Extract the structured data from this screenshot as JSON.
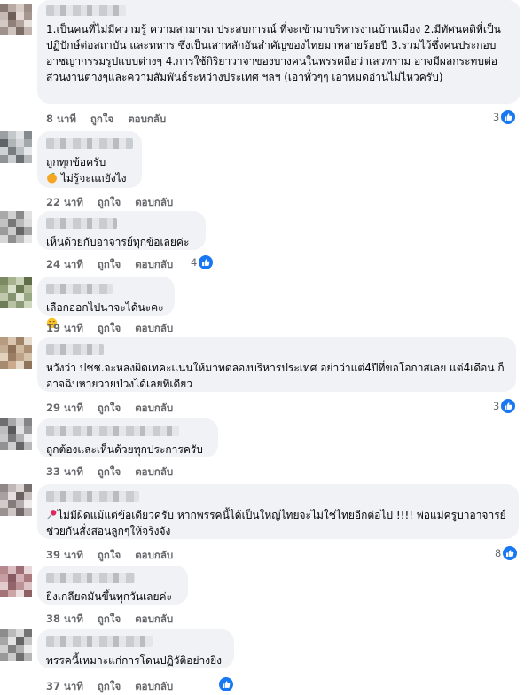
{
  "labels": {
    "like": "ถูกใจ",
    "reply": "ตอบกลับ"
  },
  "comments": [
    {
      "text": "1.เป็นคนที่ไม่มีความรู้ ความสามารถ ประสบการณ์ ที่จะเข้ามาบริหารงานบ้านเมือง 2.มีทัศนคติที่เป็นปฏิปักษ์ต่อสถาบัน และทหาร ซึ่งเป็นเสาหลักอันสำคัญของไทยมาหลายร้อยปี 3.รวมไว้ซึ่งคนประกอบอาชญากรรมรูปแบบต่างๆ 4.การใช้กิริยาวาจาของบางคนในพรรคถือว่าเลวทราม อาจมีผลกระทบต่อส่วนงานต่างๆและความสัมพันธ์ระหว่างประเทศ ฯลฯ (เอาทั่วๆๆ เอาหมดอ่านไม่ไหวครับ)",
      "time": "8 นาที",
      "likes": "3"
    },
    {
      "text": "ถูกทุกข้อครับ",
      "text2": "ไม่รู้จะแถยังไง",
      "time": "22 นาที",
      "likes": ""
    },
    {
      "text": "เห็นด้วยกับอาจารย์ทุกข้อเลยค่ะ",
      "time": "24 นาที",
      "likes": "4"
    },
    {
      "text": "เลือกออกไปน่าจะได้นะคะ",
      "time": "19 นาที",
      "likes": ""
    },
    {
      "text": "หวังว่า ปชช.จะหลงผิดเทคะแนนให้มาทดลองบริหารประเทศ อย่าว่าแต่4ปีที่ขอโอกาสเลย แต่4เดือน ก็อาจฉิบหายวายป่วงได้เลยทีเดียว",
      "time": "29 นาที",
      "likes": "3"
    },
    {
      "text": "ถูกต้องและเห็นด้วยทุกประการครับ",
      "time": "33 นาที",
      "likes": ""
    },
    {
      "text": "ไม่มีผิดแม้แต่ข้อเดียวครับ หากพรรคนี้ได้เป็นใหญ่ไทยจะไม่ใช่ไทยอีกต่อไป !!!! พ่อแม่ครูบาอาจารย์ ช่วยกันสั่งสอนลูกๆให้จริงจัง",
      "time": "39 นาที",
      "likes": "8"
    },
    {
      "text": "ยิ่งเกลียดมันขึ้นทุกวันเลยค่ะ",
      "time": "38 นาที",
      "likes": ""
    },
    {
      "text": "พรรคนี้เหมาะแก่การโดนปฏิวัติอย่างยิ่ง",
      "time": "37 นาที",
      "likes": ""
    }
  ],
  "colors": {
    "like": "#1877f2",
    "bubble": "#f0f2f5",
    "meta": "#65676b"
  }
}
